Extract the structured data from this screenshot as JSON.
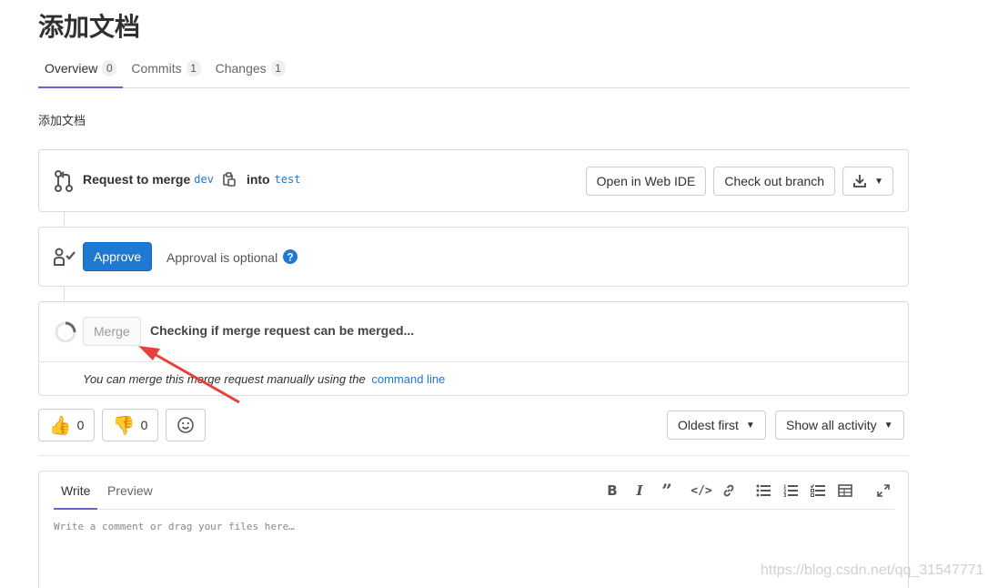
{
  "page": {
    "title": "添加文档",
    "description": "添加文档"
  },
  "tabs": [
    {
      "label": "Overview",
      "count": "0"
    },
    {
      "label": "Commits",
      "count": "1"
    },
    {
      "label": "Changes",
      "count": "1"
    }
  ],
  "merge_info": {
    "request_to_merge": "Request to merge",
    "source_branch": "dev",
    "into": "into",
    "target_branch": "test",
    "open_web_ide": "Open in Web IDE",
    "check_out_branch": "Check out branch"
  },
  "approval": {
    "approve_label": "Approve",
    "optional_text": "Approval is optional"
  },
  "merge": {
    "merge_label": "Merge",
    "status_text": "Checking if merge request can be merged...",
    "manual_text": "You can merge this merge request manually using the",
    "command_line_link": "command line"
  },
  "reactions": {
    "thumbs_up_count": "0",
    "thumbs_down_count": "0"
  },
  "sorting": {
    "order_label": "Oldest first",
    "filter_label": "Show all activity"
  },
  "editor": {
    "write_tab": "Write",
    "preview_tab": "Preview",
    "placeholder": "Write a comment or drag your files here…"
  },
  "watermark": "https://blog.csdn.net/qq_31547771",
  "colors": {
    "accent": "#1f78d1",
    "tab_active_border": "#6666c4",
    "arrow": "#e8403a"
  },
  "icons": {
    "merge_request": "merge-request-icon",
    "copy": "copy-icon",
    "download": "download-icon",
    "approval": "approval-icon",
    "help": "question-circle-icon",
    "spinner": "loading-spinner-icon",
    "thumbs_up": "thumbs-up-emoji",
    "thumbs_down": "thumbs-down-emoji",
    "emoji_picker": "smiley-icon"
  }
}
